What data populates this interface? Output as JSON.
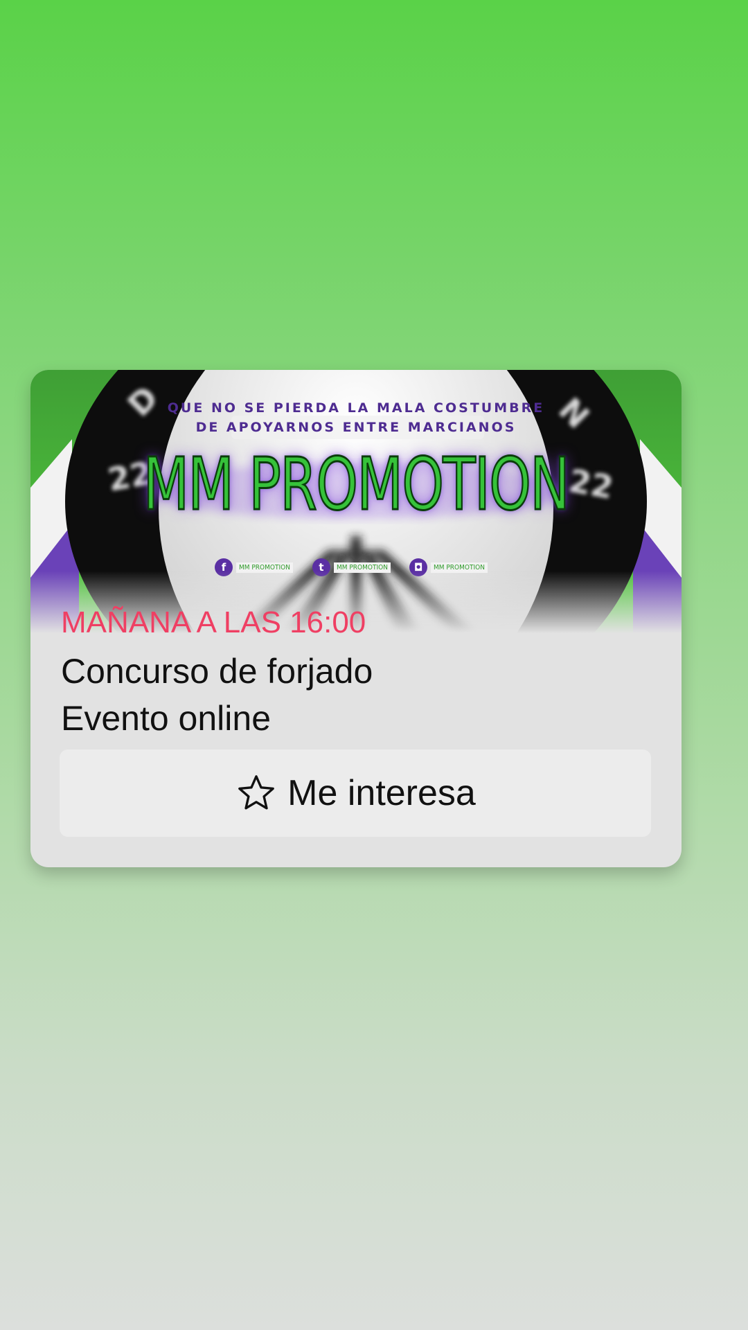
{
  "event_card": {
    "banner": {
      "tagline_line1": "QUE NO SE PIERDA LA MALA COSTUMBRE",
      "tagline_line2": "DE APOYARNOS ENTRE MARCIANOS",
      "brand": "MM PROMOTION",
      "social": [
        {
          "icon": "facebook-icon",
          "glyph": "f",
          "label": "MM PROMOTION"
        },
        {
          "icon": "twitter-icon",
          "glyph": "t",
          "label": "MM PROMOTION"
        },
        {
          "icon": "instagram-icon",
          "glyph": "◘",
          "label": "MM PROMOTION"
        }
      ]
    },
    "date": "MAÑANA A LAS 16:00",
    "title": "Concurso de forjado",
    "subtitle": "Evento online",
    "interest_button": {
      "icon": "star-outline-icon",
      "label": "Me interesa"
    }
  },
  "colors": {
    "date_accent": "#ef3f63",
    "brand_green": "#36c23a",
    "brand_purple": "#5a2fa3"
  }
}
